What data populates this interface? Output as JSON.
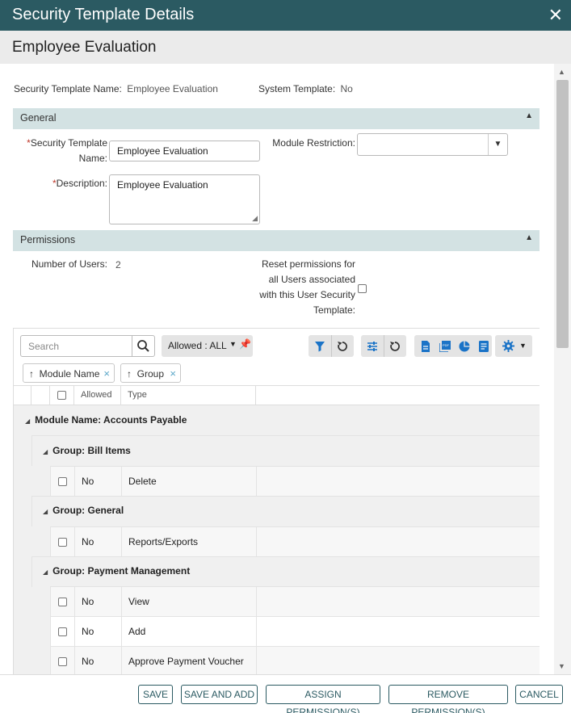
{
  "dialog": {
    "title": "Security Template Details",
    "close_glyph": "✕"
  },
  "subheader": {
    "title": "Employee Evaluation"
  },
  "summary": {
    "name_label": "Security Template Name:",
    "name_value": "Employee Evaluation",
    "system_label": "System Template:",
    "system_value": "No"
  },
  "general": {
    "title": "General",
    "name_label_req": "*",
    "name_label_line1": "Security Template",
    "name_label_line2": "Name:",
    "name_value": "Employee Evaluation",
    "module_label": "Module Restriction:",
    "module_value": "",
    "desc_label_req": "*",
    "desc_label": "Description:",
    "desc_value": "Employee Evaluation"
  },
  "permissions": {
    "title": "Permissions",
    "users_label": "Number of Users:",
    "users_value": "2",
    "reset_line1": "Reset permissions for",
    "reset_line2": "all Users associated",
    "reset_line3": "with this User Security",
    "reset_line4": "Template:"
  },
  "grid": {
    "search_placeholder": "Search",
    "filter_pill": "Allowed : ALL",
    "chips": [
      "Module Name",
      "Group"
    ],
    "chip_arrow": "↑",
    "chip_remove": "×",
    "columns": [
      "Allowed",
      "Type"
    ],
    "module_group": "Module Name: Accounts Payable",
    "groups": [
      {
        "label": "Group: Bill Items",
        "rows": [
          {
            "allowed": "No",
            "type": "Delete"
          }
        ]
      },
      {
        "label": "Group: General",
        "rows": [
          {
            "allowed": "No",
            "type": "Reports/Exports"
          }
        ]
      },
      {
        "label": "Group: Payment Management",
        "rows": [
          {
            "allowed": "No",
            "type": "View"
          },
          {
            "allowed": "No",
            "type": "Add"
          },
          {
            "allowed": "No",
            "type": "Approve Payment Voucher"
          }
        ]
      }
    ]
  },
  "footer": {
    "save": "SAVE",
    "save_and_add": "SAVE AND ADD",
    "assign": "ASSIGN PERMISSION(S)",
    "remove": "REMOVE PERMISSION(S)",
    "cancel": "CANCEL"
  },
  "colors": {
    "header": "#2b5a62",
    "section": "#d3e2e3",
    "icon_blue": "#1a73c7"
  }
}
